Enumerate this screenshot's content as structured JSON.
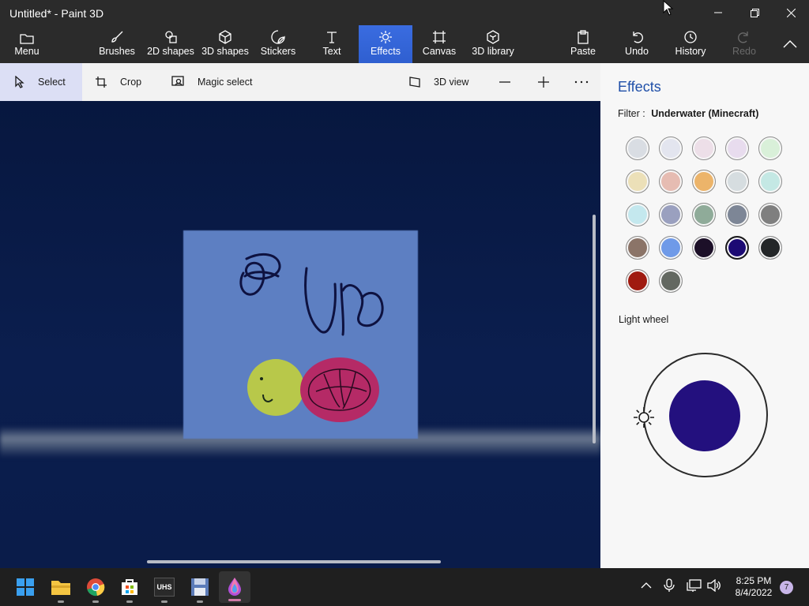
{
  "window": {
    "title": "Untitled* - Paint 3D"
  },
  "ribbon": {
    "menu_label": "Menu",
    "items": [
      {
        "label": "Brushes",
        "icon": "brush-icon"
      },
      {
        "label": "2D shapes",
        "icon": "2d-shapes-icon"
      },
      {
        "label": "3D shapes",
        "icon": "3d-shapes-icon"
      },
      {
        "label": "Stickers",
        "icon": "stickers-icon"
      },
      {
        "label": "Text",
        "icon": "text-icon"
      },
      {
        "label": "Effects",
        "icon": "effects-icon",
        "active": true
      },
      {
        "label": "Canvas",
        "icon": "canvas-icon"
      },
      {
        "label": "3D library",
        "icon": "3d-library-icon"
      }
    ],
    "paste_label": "Paste",
    "undo_label": "Undo",
    "history_label": "History",
    "redo_label": "Redo",
    "active_color": "#3a6ce0"
  },
  "toolbar": {
    "select_label": "Select",
    "crop_label": "Crop",
    "magic_select_label": "Magic select",
    "view_3d_label": "3D view"
  },
  "panel": {
    "title": "Effects",
    "filter_prefix": "Filter :",
    "filter_value": "Underwater (Minecraft)",
    "swatches": [
      "#d9dde3",
      "#e3e5ef",
      "#eddfe8",
      "#e8dcee",
      "#d9f0d9",
      "#ece0b8",
      "#e6bcb2",
      "#ecb46a",
      "#d6dde0",
      "#c4e8e4",
      "#c4e8ee",
      "#9aa0bf",
      "#8fab99",
      "#7d8696",
      "#7f7f7f",
      "#8b7468",
      "#6f9ae8",
      "#1c1028",
      "#1c0a74",
      "#232628",
      "#a01a10",
      "#636861"
    ],
    "selected_swatch_index": 18,
    "light_wheel_label": "Light wheel",
    "light_color": "#23107e"
  },
  "taskbar": {
    "apps": [
      "start-icon",
      "file-explorer-icon",
      "chrome-icon",
      "store-icon",
      "uhs-app-icon",
      "floppy-app-icon",
      "paint-3d-icon"
    ],
    "uhs_label": "UHS",
    "time": "8:25 PM",
    "date": "8/4/2022",
    "notification_count": "7"
  }
}
